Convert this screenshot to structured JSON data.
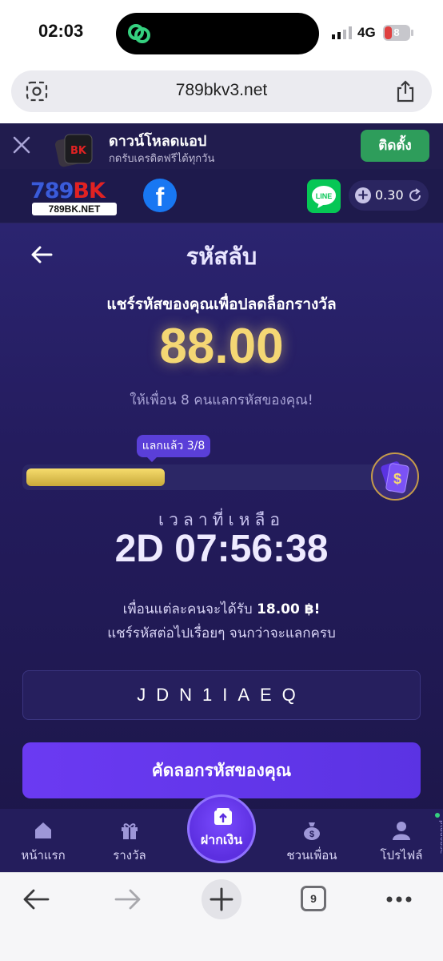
{
  "status_bar": {
    "time": "02:03",
    "network": "4G",
    "battery": "8"
  },
  "browser": {
    "url": "789bkv3.net",
    "tab_count": "9"
  },
  "banner": {
    "title": "ดาวน์โหลดแอป",
    "subtitle": "กดรับเครดิตฟรีได้ทุกวัน",
    "install_label": "ติดตั้ง",
    "app_icon_text": "BK"
  },
  "header": {
    "logo_main": "789",
    "logo_accent": "BK",
    "logo_domain": "789BK.NET",
    "facebook_label": "f",
    "line_label": "LINE",
    "balance": "0.30"
  },
  "page": {
    "title": "รหัสลับ",
    "subheading": "แชร์รหัสของคุณเพื่อปลดล็อกรางวัล",
    "reward_amount": "88.00",
    "invite_text": "ให้เพื่อน 8 คนแลกรหัสของคุณ!",
    "progress_label": "แลกแล้ว 3/8",
    "progress_redeemed": 3,
    "progress_total": 8,
    "time_left_label": "เวลาที่เหลือ",
    "countdown": "2D 07:56:38",
    "note_line1_prefix": "เพื่อนแต่ละคนจะได้รับ",
    "note_line1_amount": "18.00 ฿!",
    "note_line2": "แชร์รหัสต่อไปเรื่อยๆ จนกว่าจะแลกครบ",
    "code": "JDN1IAEQ",
    "copy_button": "คัดลอกรหัสของคุณ"
  },
  "bottom_nav": {
    "home": "หน้าแรก",
    "rewards": "รางวัล",
    "deposit": "ฝากเงิน",
    "invite": "ชวนเพื่อน",
    "profile": "โปรไฟล์"
  },
  "side_text": "ptdd0bse",
  "colors": {
    "accent_purple": "#5b33e3",
    "gold": "#f4d774",
    "background": "#1b1546",
    "install_green": "#2e9d5b"
  }
}
